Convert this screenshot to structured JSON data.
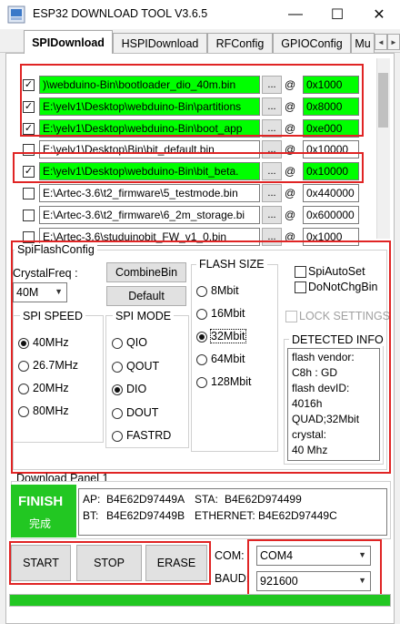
{
  "window": {
    "title": "ESP32 DOWNLOAD TOOL V3.6.5",
    "minimize": "—",
    "maximize": "☐",
    "close": "✕"
  },
  "tabs": [
    {
      "label": "SPIDownload",
      "active": true
    },
    {
      "label": "HSPIDownload",
      "active": false
    },
    {
      "label": "RFConfig",
      "active": false
    },
    {
      "label": "GPIOConfig",
      "active": false
    },
    {
      "label": "Mu",
      "active": false
    }
  ],
  "tab_scroll": {
    "left": "◄",
    "right": "►"
  },
  "files": [
    {
      "checked": true,
      "path": ")\\webduino-Bin\\bootloader_dio_40m.bin",
      "address": "0x1000",
      "green": true
    },
    {
      "checked": true,
      "path": "E:\\yelv1\\Desktop\\webduino-Bin\\partitions",
      "address": "0x8000",
      "green": true
    },
    {
      "checked": true,
      "path": "E:\\yelv1\\Desktop\\webduino-Bin\\boot_app",
      "address": "0xe000",
      "green": true
    },
    {
      "checked": false,
      "path": "E:\\yelv1\\Desktop\\Bin\\bit_default.bin",
      "address": "0x10000",
      "green": false
    },
    {
      "checked": true,
      "path": "E:\\yelv1\\Desktop\\webduino-Bin\\bit_beta.",
      "address": "0x10000",
      "green": true
    },
    {
      "checked": false,
      "path": "E:\\Artec-3.6\\t2_firmware\\5_testmode.bin",
      "address": "0x440000",
      "green": false
    },
    {
      "checked": false,
      "path": "E:\\Artec-3.6\\t2_firmware\\6_2m_storage.bi",
      "address": "0x600000",
      "green": false
    },
    {
      "checked": false,
      "path": "E:\\Artec-3.6\\studuinobit_FW_v1_0.bin",
      "address": "0x1000",
      "green": false
    }
  ],
  "file_row": {
    "browse": "...",
    "at": "@"
  },
  "spi_config": {
    "title": "SpiFlashConfig",
    "crystal_label": "CrystalFreq :",
    "crystal_value": "40M",
    "combine_button": "CombineBin",
    "default_button": "Default",
    "spi_speed": {
      "title": "SPI SPEED",
      "options": [
        "40MHz",
        "26.7MHz",
        "20MHz",
        "80MHz"
      ],
      "selected": "40MHz"
    },
    "spi_mode": {
      "title": "SPI MODE",
      "options": [
        "QIO",
        "QOUT",
        "DIO",
        "DOUT",
        "FASTRD"
      ],
      "selected": "DIO"
    },
    "flash_size": {
      "title": "FLASH SIZE",
      "options": [
        "8Mbit",
        "16Mbit",
        "32Mbit",
        "64Mbit",
        "128Mbit"
      ],
      "selected": "32Mbit"
    },
    "spi_auto_set": "SpiAutoSet",
    "do_not_chg_bin": "DoNotChgBin",
    "lock_settings": "LOCK SETTINGS",
    "detected_info": {
      "title": "DETECTED INFO",
      "text": "flash vendor:\nC8h : GD\nflash devID:\n4016h\nQUAD;32Mbit\ncrystal:\n40 Mhz"
    }
  },
  "download_panel": {
    "title": "Download Panel 1",
    "status": "FINISH",
    "status_sub": "完成",
    "ap_label": "AP:",
    "ap_value": "B4E62D97449A",
    "sta_label": "STA:",
    "sta_value": "B4E62D974499",
    "bt_label": "BT:",
    "bt_value": "B4E62D97449B",
    "eth_label": "ETHERNET:",
    "eth_value": "B4E62D97449C"
  },
  "controls": {
    "start": "START",
    "stop": "STOP",
    "erase": "ERASE",
    "com_label": "COM:",
    "com_value": "COM4",
    "baud_label": "BAUD:",
    "baud_value": "921600"
  },
  "progress": {
    "value": 1.0,
    "color": "#22c722"
  },
  "colors": {
    "highlight_green": "#00ff00",
    "finish_green": "#22c722",
    "annotation_red": "#e02424"
  }
}
